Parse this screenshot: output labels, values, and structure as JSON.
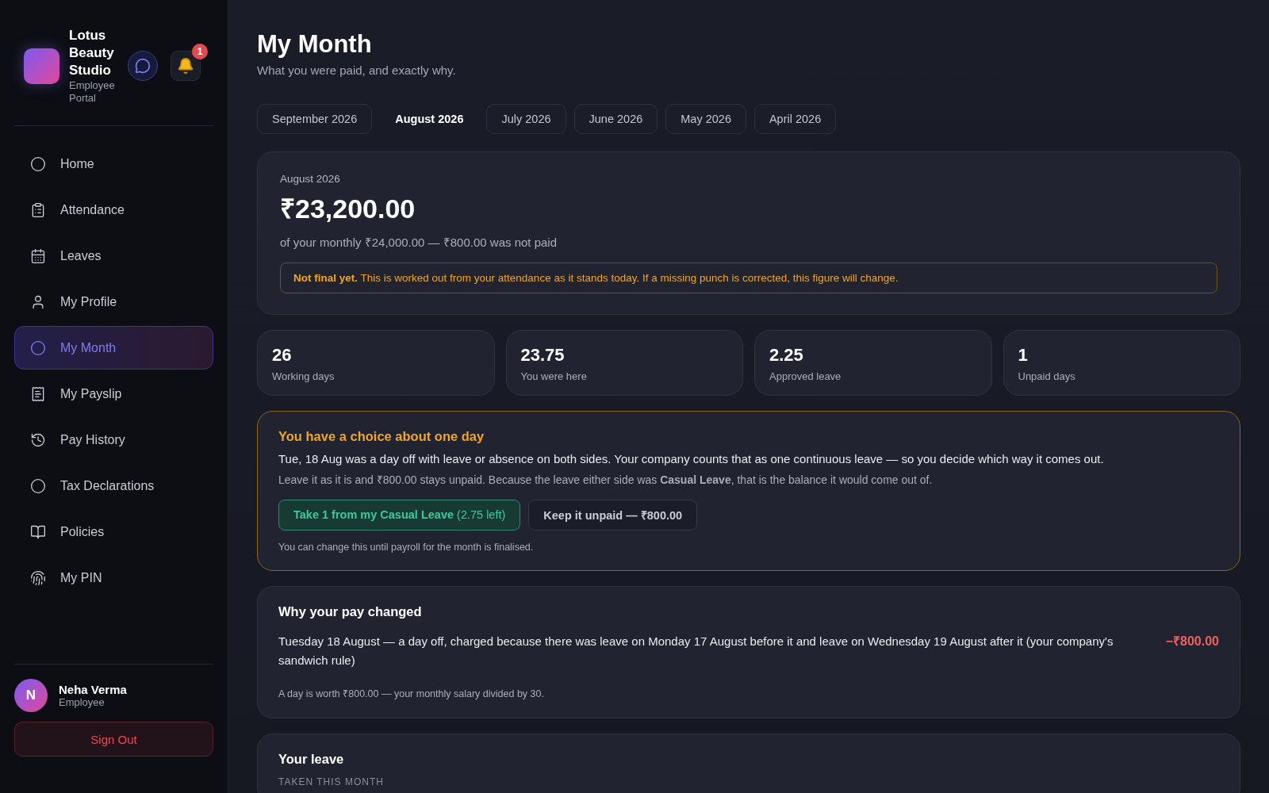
{
  "brand": {
    "name": "Lotus Beauty Studio",
    "subtitle": "Employee Portal",
    "notifications": "1"
  },
  "nav": [
    {
      "label": "Home",
      "selected": false
    },
    {
      "label": "Attendance",
      "selected": false
    },
    {
      "label": "Leaves",
      "selected": false
    },
    {
      "label": "My Profile",
      "selected": false
    },
    {
      "label": "My Month",
      "selected": true
    },
    {
      "label": "My Payslip",
      "selected": false
    },
    {
      "label": "Pay History",
      "selected": false
    },
    {
      "label": "Tax Declarations",
      "selected": false
    },
    {
      "label": "Policies",
      "selected": false
    },
    {
      "label": "My PIN",
      "selected": false
    }
  ],
  "user": {
    "initial": "N",
    "name": "Neha Verma",
    "role": "Employee"
  },
  "sign_out": "Sign Out",
  "page": {
    "title": "My Month",
    "subtitle": "What you were paid, and exactly why."
  },
  "months": [
    {
      "label": "September 2026",
      "selected": false
    },
    {
      "label": "August 2026",
      "selected": true
    },
    {
      "label": "July 2026",
      "selected": false
    },
    {
      "label": "June 2026",
      "selected": false
    },
    {
      "label": "May 2026",
      "selected": false
    },
    {
      "label": "April 2026",
      "selected": false
    }
  ],
  "summary": {
    "period": "August 2026",
    "amount": "₹23,200.00",
    "note": "of your monthly ₹24,000.00 — ₹800.00 was not paid",
    "warning": "**Not final yet.** This is worked out from your attendance as it stands today. If a missing punch is corrected, this figure will change."
  },
  "stats": [
    {
      "value": "26",
      "label": "Working days"
    },
    {
      "value": "23.75",
      "label": "You were here"
    },
    {
      "value": "2.25",
      "label": "Approved leave"
    },
    {
      "value": "1",
      "label": "Unpaid days"
    }
  ],
  "choice": {
    "title": "You have a choice about one day",
    "text": "Tue, 18 Aug was a day off with leave or absence on both sides. Your company counts that as one continuous leave — so you decide which way it comes out.",
    "detail": "Leave it as it is and ₹800.00 stays unpaid. Because the leave either side was **Casual Leave**, that is the balance it would come out of.",
    "options": [
      {
        "label": "Take 1 from my Casual Leave",
        "extra": "(2.75 left)",
        "selected": true
      },
      {
        "label": "Keep it unpaid — ₹800.00",
        "selected": false
      }
    ],
    "footnote": "You can change this until payroll for the month is finalised."
  },
  "why": {
    "title": "Why your pay changed",
    "items": [
      {
        "text": "Tuesday 18 August — a day off, charged because there was leave on Monday 17 August before it and leave on Wednesday 19 August after it (your company's sandwich rule)",
        "amount": "−₹800.00"
      }
    ],
    "footnote": "A day is worth ₹800.00 — your monthly salary divided by 30."
  },
  "leave": {
    "title": "Your leave",
    "section": "TAKEN THIS MONTH"
  }
}
